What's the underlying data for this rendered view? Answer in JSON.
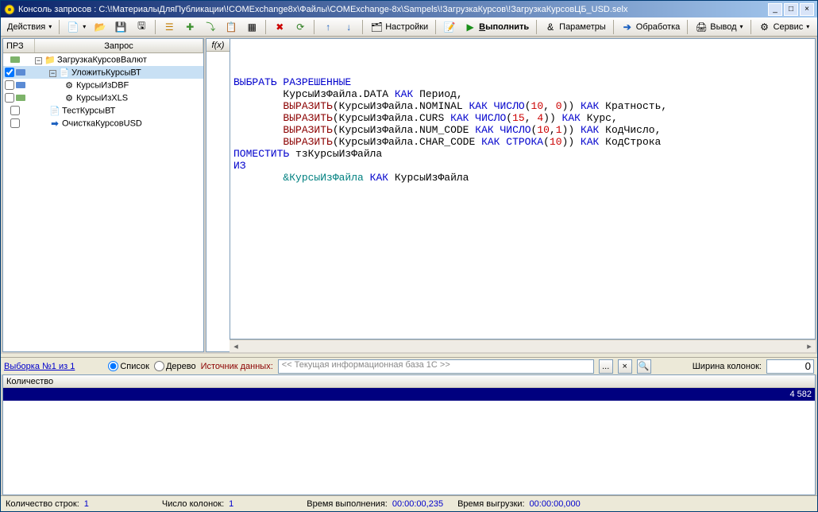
{
  "window": {
    "title": "Консоль запросов : C:\\!МатериалыДляПубликации\\!COMExchange8x\\Файлы\\COMExchange-8x\\Sampels\\!ЗагрузкаКурсов\\!ЗагрузкаКурсовЦБ_USD.selx"
  },
  "toolbar": {
    "actions": "Действия",
    "settings": "Настройки",
    "run": "Выполнить",
    "params": "Параметры",
    "processing": "Обработка",
    "output": "Вывод",
    "service": "Сервис"
  },
  "left_panel": {
    "h1": "ПРЗ",
    "h2": "Запрос",
    "items": [
      {
        "indent": 0,
        "exp": "-",
        "icon": "📁",
        "label": "ЗагрузкаКурсовВалют",
        "flag": "g"
      },
      {
        "indent": 1,
        "exp": "-",
        "icon": "📄",
        "label": "УложитьКурсыВТ",
        "sel": true,
        "chk": true,
        "flag": "b"
      },
      {
        "indent": 2,
        "exp": "",
        "icon": "⚙",
        "label": "КурсыИзDBF",
        "flag": "b"
      },
      {
        "indent": 2,
        "exp": "",
        "icon": "⚙",
        "label": "КурсыИзXLS",
        "flag": "g"
      },
      {
        "indent": 1,
        "exp": "",
        "icon": "📄",
        "label": "ТестКурсыВТ"
      },
      {
        "indent": 1,
        "exp": "",
        "icon": "➡",
        "label": "ОчисткаКурсовUSD",
        "blue": true
      }
    ]
  },
  "editor": {
    "fx": "f(x)",
    "lines": [
      [
        [
          "kw",
          "ВЫБРАТЬ РАЗРЕШЕННЫЕ"
        ]
      ],
      [
        [
          "",
          "\tКурсыИзФайла.DATA "
        ],
        [
          "kw",
          "КАК "
        ],
        [
          "",
          "Период,"
        ]
      ],
      [
        [
          "",
          "\t"
        ],
        [
          "kw2",
          "ВЫРАЗИТЬ"
        ],
        [
          "",
          "(КурсыИзФайла.NOMINAL "
        ],
        [
          "kw",
          "КАК ЧИСЛО"
        ],
        [
          "",
          "("
        ],
        [
          "num",
          "10"
        ],
        [
          "",
          ", "
        ],
        [
          "num",
          "0"
        ],
        [
          "",
          ")) "
        ],
        [
          "kw",
          "КАК "
        ],
        [
          "",
          "Кратность,"
        ]
      ],
      [
        [
          "",
          "\t"
        ],
        [
          "kw2",
          "ВЫРАЗИТЬ"
        ],
        [
          "",
          "(КурсыИзФайла.CURS "
        ],
        [
          "kw",
          "КАК ЧИСЛО"
        ],
        [
          "",
          "("
        ],
        [
          "num",
          "15"
        ],
        [
          "",
          ", "
        ],
        [
          "num",
          "4"
        ],
        [
          "",
          ")) "
        ],
        [
          "kw",
          "КАК "
        ],
        [
          "",
          "Курс,"
        ]
      ],
      [
        [
          "",
          "\t"
        ],
        [
          "kw2",
          "ВЫРАЗИТЬ"
        ],
        [
          "",
          "(КурсыИзФайла.NUM_CODE "
        ],
        [
          "kw",
          "КАК ЧИСЛО"
        ],
        [
          "",
          "("
        ],
        [
          "num",
          "10"
        ],
        [
          "",
          ","
        ],
        [
          "num",
          "1"
        ],
        [
          "",
          ")) "
        ],
        [
          "kw",
          "КАК "
        ],
        [
          "",
          "КодЧисло,"
        ]
      ],
      [
        [
          "",
          "\t"
        ],
        [
          "kw2",
          "ВЫРАЗИТЬ"
        ],
        [
          "",
          "(КурсыИзФайла.CHAR_CODE "
        ],
        [
          "kw",
          "КАК СТРОКА"
        ],
        [
          "",
          "("
        ],
        [
          "num",
          "10"
        ],
        [
          "",
          ")) "
        ],
        [
          "kw",
          "КАК "
        ],
        [
          "",
          "КодСтрока"
        ]
      ],
      [
        [
          "kw",
          "ПОМЕСТИТЬ "
        ],
        [
          "",
          "тзКурсыИзФайла"
        ]
      ],
      [
        [
          "kw",
          "ИЗ"
        ]
      ],
      [
        [
          "",
          "\t"
        ],
        [
          "grn",
          "&КурсыИзФайла "
        ],
        [
          "kw",
          "КАК "
        ],
        [
          "",
          "КурсыИзФайла"
        ]
      ]
    ]
  },
  "midbar": {
    "selection": "Выборка №1 из 1",
    "rlist": "Список",
    "rtree": "Дерево",
    "src_label": "Источник данных:",
    "src_value": "<< Текущая информационная база 1C >>",
    "colw_label": "Ширина колонок:",
    "colw_value": "0"
  },
  "result": {
    "header": "Количество",
    "row_value": "4 582"
  },
  "status": {
    "rows_label": "Количество строк:",
    "rows": "1",
    "cols_label": "Число колонок:",
    "cols": "1",
    "exec_label": "Время выполнения:",
    "exec": "00:00:00,235",
    "dump_label": "Время выгрузки:",
    "dump": "00:00:00,000"
  }
}
